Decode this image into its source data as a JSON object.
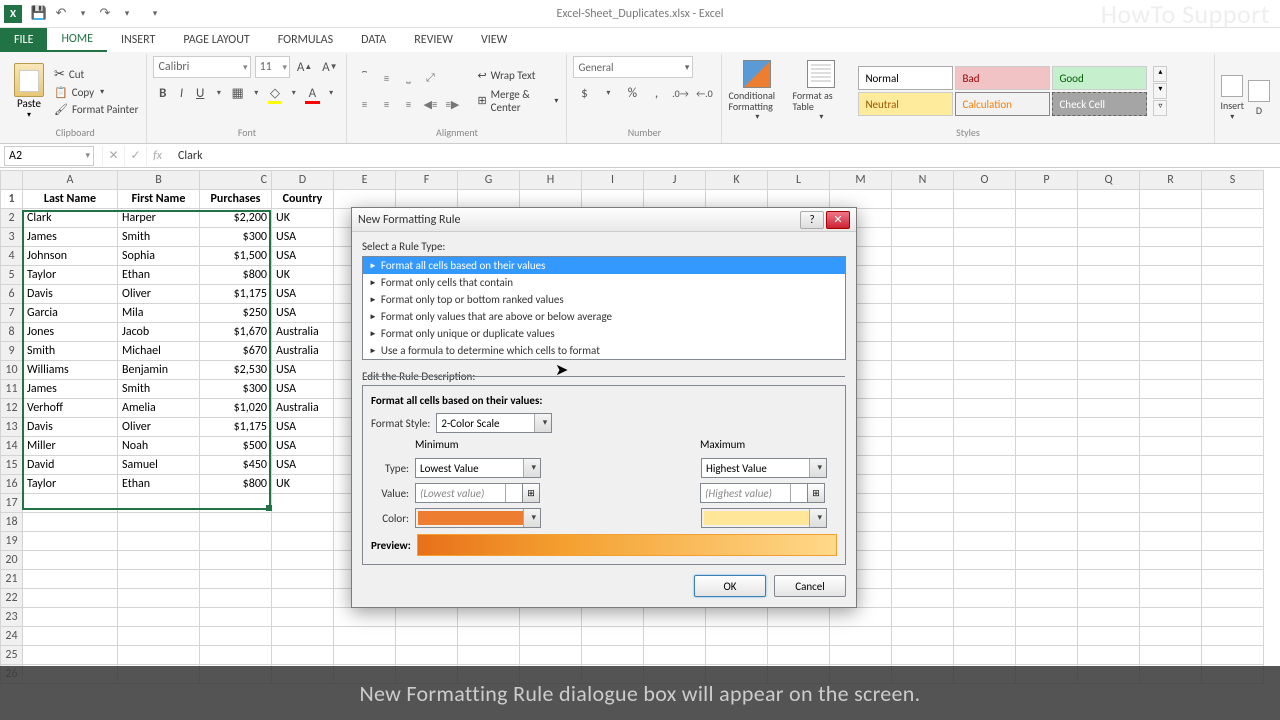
{
  "app": {
    "title": "Excel-Sheet_Duplicates.xlsx - Excel",
    "watermark": "HowTo Support"
  },
  "quick_access": {
    "save": "💾",
    "undo": "↶",
    "redo": "↷",
    "custom": "▾"
  },
  "tabs": [
    "FILE",
    "HOME",
    "INSERT",
    "PAGE LAYOUT",
    "FORMULAS",
    "DATA",
    "REVIEW",
    "VIEW"
  ],
  "ribbon": {
    "clipboard": {
      "label": "Clipboard",
      "paste": "Paste",
      "cut": "Cut",
      "copy": "Copy",
      "painter": "Format Painter"
    },
    "font": {
      "label": "Font",
      "name": "Calibri",
      "size": "11"
    },
    "alignment": {
      "label": "Alignment",
      "wrap": "Wrap Text",
      "merge": "Merge & Center"
    },
    "number": {
      "label": "Number",
      "format": "General"
    },
    "styles": {
      "label": "Styles",
      "cf": "Conditional Formatting",
      "fat": "Format as Table",
      "gallery": {
        "normal": "Normal",
        "bad": "Bad",
        "good": "Good",
        "neutral": "Neutral",
        "calc": "Calculation",
        "check": "Check Cell"
      }
    },
    "cells": {
      "insert": "Insert",
      "delete": "D"
    }
  },
  "formula_bar": {
    "name_box": "A2",
    "fx": "fx",
    "value": "Clark"
  },
  "columns": [
    "A",
    "B",
    "C",
    "D",
    "E",
    "F",
    "G",
    "H",
    "I",
    "J",
    "K",
    "L",
    "M",
    "N",
    "O",
    "P",
    "Q",
    "R",
    "S"
  ],
  "headers": {
    "A": "Last Name",
    "B": "First Name",
    "C": "Purchases",
    "D": "Country"
  },
  "rows": [
    {
      "A": "Clark",
      "B": "Harper",
      "C": "$2,200",
      "D": "UK"
    },
    {
      "A": "James",
      "B": "Smith",
      "C": "$300",
      "D": "USA"
    },
    {
      "A": "Johnson",
      "B": "Sophia",
      "C": "$1,500",
      "D": "USA"
    },
    {
      "A": "Taylor",
      "B": "Ethan",
      "C": "$800",
      "D": "UK"
    },
    {
      "A": "Davis",
      "B": "Oliver",
      "C": "$1,175",
      "D": "USA"
    },
    {
      "A": "Garcia",
      "B": "Mila",
      "C": "$250",
      "D": "USA"
    },
    {
      "A": "Jones",
      "B": "Jacob",
      "C": "$1,670",
      "D": "Australia"
    },
    {
      "A": "Smith",
      "B": "Michael",
      "C": "$670",
      "D": "Australia"
    },
    {
      "A": "Williams",
      "B": "Benjamin",
      "C": "$2,530",
      "D": "USA"
    },
    {
      "A": "James",
      "B": "Smith",
      "C": "$300",
      "D": "USA"
    },
    {
      "A": "Verhoff",
      "B": "Amelia",
      "C": "$1,020",
      "D": "Australia"
    },
    {
      "A": "Davis",
      "B": "Oliver",
      "C": "$1,175",
      "D": "USA"
    },
    {
      "A": "Miller",
      "B": "Noah",
      "C": "$500",
      "D": "USA"
    },
    {
      "A": "David",
      "B": "Samuel",
      "C": "$450",
      "D": "USA"
    },
    {
      "A": "Taylor",
      "B": "Ethan",
      "C": "$800",
      "D": "UK"
    }
  ],
  "dialog": {
    "title": "New Formatting Rule",
    "select_label": "Select a Rule Type:",
    "rules": [
      "Format all cells based on their values",
      "Format only cells that contain",
      "Format only top or bottom ranked values",
      "Format only values that are above or below average",
      "Format only unique or duplicate values",
      "Use a formula to determine which cells to format"
    ],
    "edit_label": "Edit the Rule Description:",
    "desc_title": "Format all cells based on their values:",
    "format_style_label": "Format Style:",
    "format_style": "2-Color Scale",
    "min_label": "Minimum",
    "max_label": "Maximum",
    "type_label": "Type:",
    "value_label": "Value:",
    "color_label": "Color:",
    "min_type": "Lowest Value",
    "max_type": "Highest Value",
    "min_value": "(Lowest value)",
    "max_value": "(Highest value)",
    "min_color": "#ed7d31",
    "max_color": "#ffe699",
    "preview_label": "Preview:",
    "ok": "OK",
    "cancel": "Cancel"
  },
  "caption": "New Formatting Rule dialogue box will appear on the screen."
}
